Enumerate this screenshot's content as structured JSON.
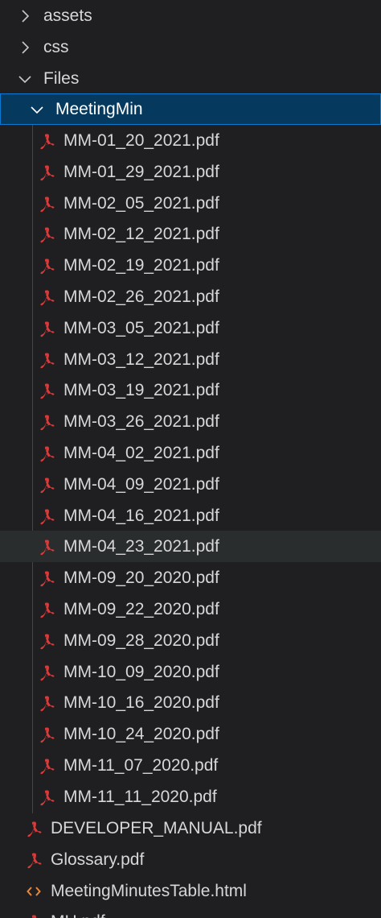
{
  "explorer": {
    "folders": [
      {
        "label": "assets",
        "expanded": false
      },
      {
        "label": "css",
        "expanded": false
      },
      {
        "label": "Files",
        "expanded": true
      },
      {
        "label": "MeetingMin",
        "expanded": true
      }
    ],
    "meeting_files": [
      "MM-01_20_2021.pdf",
      "MM-01_29_2021.pdf",
      "MM-02_05_2021.pdf",
      "MM-02_12_2021.pdf",
      "MM-02_19_2021.pdf",
      "MM-02_26_2021.pdf",
      "MM-03_05_2021.pdf",
      "MM-03_12_2021.pdf",
      "MM-03_19_2021.pdf",
      "MM-03_26_2021.pdf",
      "MM-04_02_2021.pdf",
      "MM-04_09_2021.pdf",
      "MM-04_16_2021.pdf",
      "MM-04_23_2021.pdf",
      "MM-09_20_2020.pdf",
      "MM-09_22_2020.pdf",
      "MM-09_28_2020.pdf",
      "MM-10_09_2020.pdf",
      "MM-10_16_2020.pdf",
      "MM-10_24_2020.pdf",
      "MM-11_07_2020.pdf",
      "MM-11_11_2020.pdf"
    ],
    "files_children": [
      {
        "label": "DEVELOPER_MANUAL.pdf",
        "icon": "pdf-icon"
      },
      {
        "label": "Glossary.pdf",
        "icon": "pdf-icon"
      },
      {
        "label": "MeetingMinutesTable.html",
        "icon": "html-icon"
      },
      {
        "label": "MH.pdf",
        "icon": "pdf-icon"
      }
    ]
  },
  "colors": {
    "background": "#1f1f22",
    "selected_bg": "#05395e",
    "selected_border": "#0a7ad1",
    "hover_bg": "#2a2d2e",
    "pdf_icon": "#d93a3a",
    "html_icon": "#e8893a",
    "text": "#d7d7d7"
  }
}
